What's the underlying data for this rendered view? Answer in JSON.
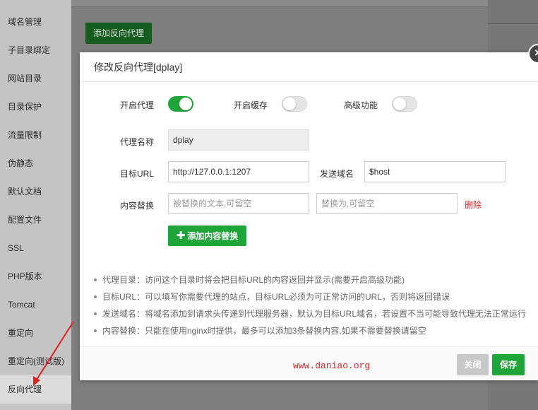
{
  "sidebar": {
    "items": [
      {
        "label": "域名管理"
      },
      {
        "label": "子目录绑定"
      },
      {
        "label": "网站目录"
      },
      {
        "label": "目录保护"
      },
      {
        "label": "流量限制"
      },
      {
        "label": "伪静态"
      },
      {
        "label": "默认文档"
      },
      {
        "label": "配置文件"
      },
      {
        "label": "SSL"
      },
      {
        "label": "PHP版本"
      },
      {
        "label": "Tomcat"
      },
      {
        "label": "重定向"
      },
      {
        "label": "重定向(测试版)"
      },
      {
        "label": "反向代理"
      }
    ],
    "active": "反向代理"
  },
  "main": {
    "add_proxy_label": "添加反向代理"
  },
  "modal": {
    "title": "修改反向代理[dplay]",
    "toggles": [
      {
        "label": "开启代理",
        "on": true
      },
      {
        "label": "开启缓存",
        "on": false
      },
      {
        "label": "高级功能",
        "on": false
      }
    ],
    "proxy_name": {
      "label": "代理名称",
      "value": "dplay"
    },
    "target_url": {
      "label": "目标URL",
      "value": "http://127.0.0.1:1207"
    },
    "send_domain": {
      "label": "发送域名",
      "value": "$host"
    },
    "content_replace": {
      "label": "内容替换",
      "from_placeholder": "被替换的文本,可留空",
      "to_placeholder": "替换为,可留空",
      "delete_label": "删除"
    },
    "add_replace_label": "添加内容替换",
    "tips": [
      "代理目录：访问这个目录时将会把目标URL的内容返回并显示(需要开启高级功能)",
      "目标URL：可以填写你需要代理的站点，目标URL必须为可正常访问的URL，否则将返回错误",
      "发送域名：将域名添加到请求头传递到代理服务器，默认为目标URL域名，若设置不当可能导致代理无法正常运行",
      "内容替换：只能在使用nginx时提供，最多可以添加3条替换内容,如果不需要替换请留空"
    ],
    "watermark": "www.daniao.org",
    "close_label": "关闭",
    "save_label": "保存"
  },
  "colors": {
    "accent": "#20a53a",
    "danger": "#e02020",
    "annotation_arrow": "#e02020"
  },
  "icons": {
    "close": "close-icon",
    "plus": "plus-icon",
    "annotation": "arrow-annotation"
  }
}
